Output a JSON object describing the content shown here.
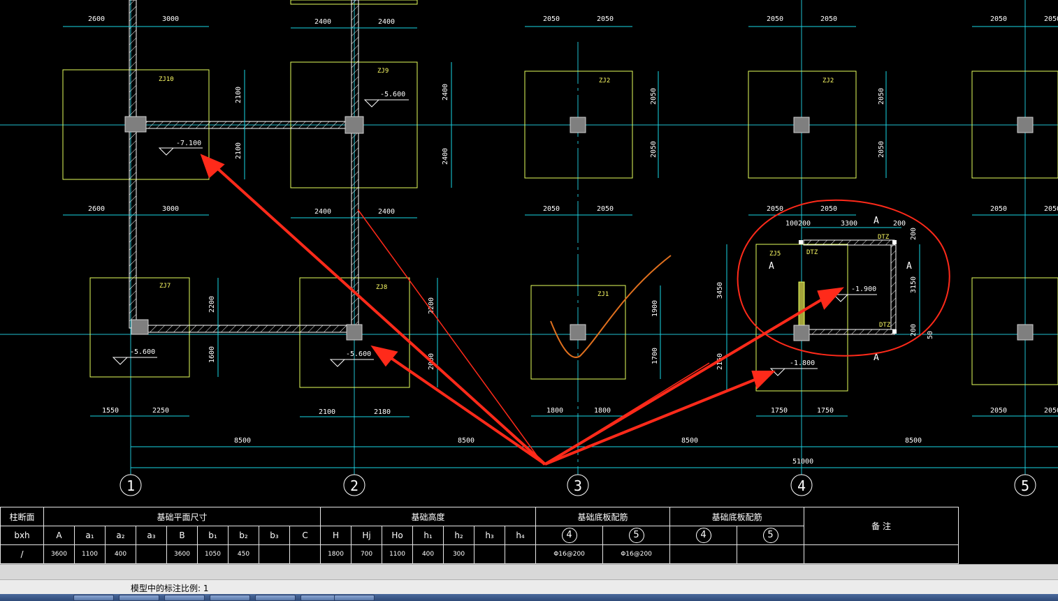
{
  "drawing": {
    "axes": [
      "1",
      "2",
      "3",
      "4",
      "5"
    ],
    "bay_dims": [
      "8500",
      "8500",
      "8500",
      "8500"
    ],
    "total_dim": "51000",
    "footings": [
      {
        "label": "ZJ10",
        "top_dims": [
          "2600",
          "3000"
        ],
        "side_dims": [
          "2100",
          "2100"
        ],
        "bottom_dims": [
          "2600",
          "3000"
        ],
        "elevation": "-7.100"
      },
      {
        "label": "ZJ9",
        "top_dims": [
          "2400",
          "2400"
        ],
        "side_dims": [
          "2400",
          "2400"
        ],
        "bottom_dims": [
          "2400",
          "2400"
        ],
        "elevation": "-5.600"
      },
      {
        "label": "ZJ2",
        "top_dims": [
          "2050",
          "2050"
        ],
        "side_dims": [
          "2050",
          "2050"
        ],
        "bottom_dims": [
          "2050",
          "2050"
        ]
      },
      {
        "label": "ZJ2",
        "top_dims": [
          "2050",
          "2050"
        ],
        "side_dims": [
          "2050",
          "2050"
        ],
        "bottom_dims": [
          "2050",
          "2050"
        ]
      },
      {
        "top_dims": [
          "2050",
          "2050"
        ],
        "bottom_dims": [
          "2050",
          "2050"
        ]
      },
      {
        "label": "ZJ7",
        "side_dims": [
          "2200",
          "1600"
        ],
        "bottom_dims": [
          "1550",
          "2250"
        ],
        "elevation": "-5.600"
      },
      {
        "label": "ZJ8",
        "side_dims": [
          "2200",
          "2000"
        ],
        "bottom_dims": [
          "2100",
          "2180"
        ],
        "elevation": "-5.600"
      },
      {
        "label": "ZJ1",
        "side_dims": [
          "1900",
          "1700"
        ],
        "bottom_dims": [
          "1800",
          "1800"
        ]
      },
      {
        "label": "ZJ5",
        "side_dims": [
          "3450",
          "2150"
        ],
        "bottom_dims": [
          "1750",
          "1750"
        ],
        "elevation": "-1.800"
      },
      {
        "bottom_dims": [
          "2050",
          "2050"
        ]
      }
    ],
    "pit": {
      "top_dims": [
        "100",
        "200",
        "3300",
        "200"
      ],
      "side_dims": [
        "3150",
        "200",
        "200",
        "50"
      ],
      "label": "DTZ",
      "section_mark": "A",
      "elevation": "-1.900"
    }
  },
  "table": {
    "header": {
      "col_section": "柱断面",
      "plan_size": "基础平面尺寸",
      "height": "基础高度",
      "rebar1": "基础底板配筋",
      "rebar2": "基础底板配筋",
      "remarks": "备 注"
    },
    "subheader": {
      "bxh": "bxh",
      "cols": [
        "A",
        "a₁",
        "a₂",
        "a₃",
        "B",
        "b₁",
        "b₂",
        "b₃",
        "C",
        "H",
        "Hj",
        "Ho",
        "h₁",
        "h₂",
        "h₃",
        "h₄"
      ],
      "rebar_marks": [
        "4",
        "5",
        "4",
        "5"
      ]
    },
    "row": {
      "section": "/",
      "values": [
        "3600",
        "1100",
        "400",
        "",
        "3600",
        "1050",
        "450",
        "",
        "",
        "1800",
        "700",
        "1100",
        "400",
        "300",
        "",
        ""
      ],
      "rebar": [
        "Φ16@200",
        "Φ16@200",
        "",
        ""
      ],
      "remarks": ""
    }
  },
  "status": {
    "text": "模型中的标注比例: 1"
  },
  "colors": {
    "background": "#000000",
    "footing": "#e6ff5c",
    "dimension": "#19d7e6",
    "column": "#808080",
    "annotation": "#ff2a1a"
  }
}
